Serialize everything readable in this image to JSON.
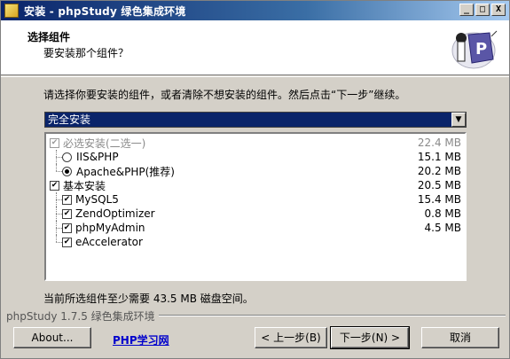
{
  "window": {
    "title": "安装 - phpStudy 绿色集成环境",
    "controls": {
      "minimize": "_",
      "maximize": "□",
      "close": "X"
    }
  },
  "header": {
    "title": "选择组件",
    "subtitle": "要安装那个组件？"
  },
  "description": "请选择你要安装的组件，或者清除不想安装的组件。然后点击“下一步”继续。",
  "install_type": {
    "selected": "完全安装"
  },
  "components": [
    {
      "label": "必选安装(二选一)",
      "size": "22.4 MB",
      "control": "checkbox",
      "checked": true,
      "disabled": true,
      "level": 0
    },
    {
      "label": "IIS&PHP",
      "size": "15.1 MB",
      "control": "radio",
      "checked": false,
      "level": 1
    },
    {
      "label": "Apache&PHP(推荐)",
      "size": "20.2 MB",
      "control": "radio",
      "checked": true,
      "level": 1
    },
    {
      "label": "基本安装",
      "size": "20.5 MB",
      "control": "checkbox",
      "checked": true,
      "level": 0
    },
    {
      "label": "MySQL5",
      "size": "15.4 MB",
      "control": "checkbox",
      "checked": true,
      "level": 1
    },
    {
      "label": "ZendOptimizer",
      "size": "0.8 MB",
      "control": "checkbox",
      "checked": true,
      "level": 1
    },
    {
      "label": "phpMyAdmin",
      "size": "4.5 MB",
      "control": "checkbox",
      "checked": true,
      "level": 1
    },
    {
      "label": "eAccelerator",
      "size": "",
      "control": "checkbox",
      "checked": true,
      "level": 1
    }
  ],
  "space_required": "当前所选组件至少需要 43.5 MB 磁盘空间。",
  "footer": {
    "brand": "phpStudy 1.7.5 绿色集成环境",
    "about_button": "About...",
    "link": "PHP学习网",
    "back_button": "< 上一步(B)",
    "next_button": "下一步(N) >",
    "cancel_button": "取消"
  }
}
